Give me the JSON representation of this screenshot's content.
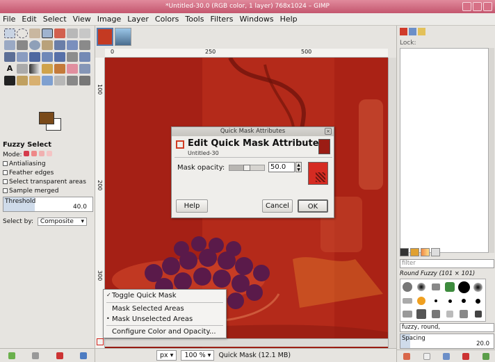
{
  "window": {
    "title": "*Untitled-30.0 (RGB color, 1 layer) 768x1024 – GIMP"
  },
  "menu": [
    "File",
    "Edit",
    "Select",
    "View",
    "Image",
    "Layer",
    "Colors",
    "Tools",
    "Filters",
    "Windows",
    "Help"
  ],
  "tool_options": {
    "title": "Fuzzy Select",
    "mode_label": "Mode:",
    "options": [
      "Antialiasing",
      "Feather edges",
      "Select transparent areas",
      "Sample merged"
    ],
    "threshold_label": "Threshold",
    "threshold_value": "40.0",
    "threshold_level": 0.35,
    "select_by_label": "Select by:",
    "select_by_value": "Composite"
  },
  "rulers": {
    "h": [
      "0",
      "250",
      "500"
    ],
    "v": [
      "100",
      "200",
      "300"
    ]
  },
  "dialog": {
    "title": "Quick Mask Attributes",
    "heading": "Edit Quick Mask Attributes",
    "subheading": "Untitled-30",
    "opacity_label": "Mask opacity:",
    "opacity_value": "50.0",
    "opacity_level": 0.5,
    "mask_color": "#d52b22",
    "help": "Help",
    "cancel": "Cancel",
    "ok": "OK"
  },
  "context_menu": {
    "toggle": "Toggle Quick Mask",
    "mask_selected": "Mask Selected Areas",
    "mask_unselected": "Mask Unselected Areas",
    "configure": "Configure Color and Opacity..."
  },
  "status": {
    "unit": "px",
    "zoom": "100 %",
    "message": "Quick Mask (12.1 MB)"
  },
  "dock": {
    "lock_label": "Lock:",
    "filter_placeholder": "filter",
    "brush_name": "Round Fuzzy (101 × 101)",
    "brush_tags": "fuzzy, round,",
    "spacing_label": "Spacing",
    "spacing_value": "20.0"
  },
  "colors": {
    "accent_title": "#c4566e",
    "quickmask": "#c33b24"
  }
}
